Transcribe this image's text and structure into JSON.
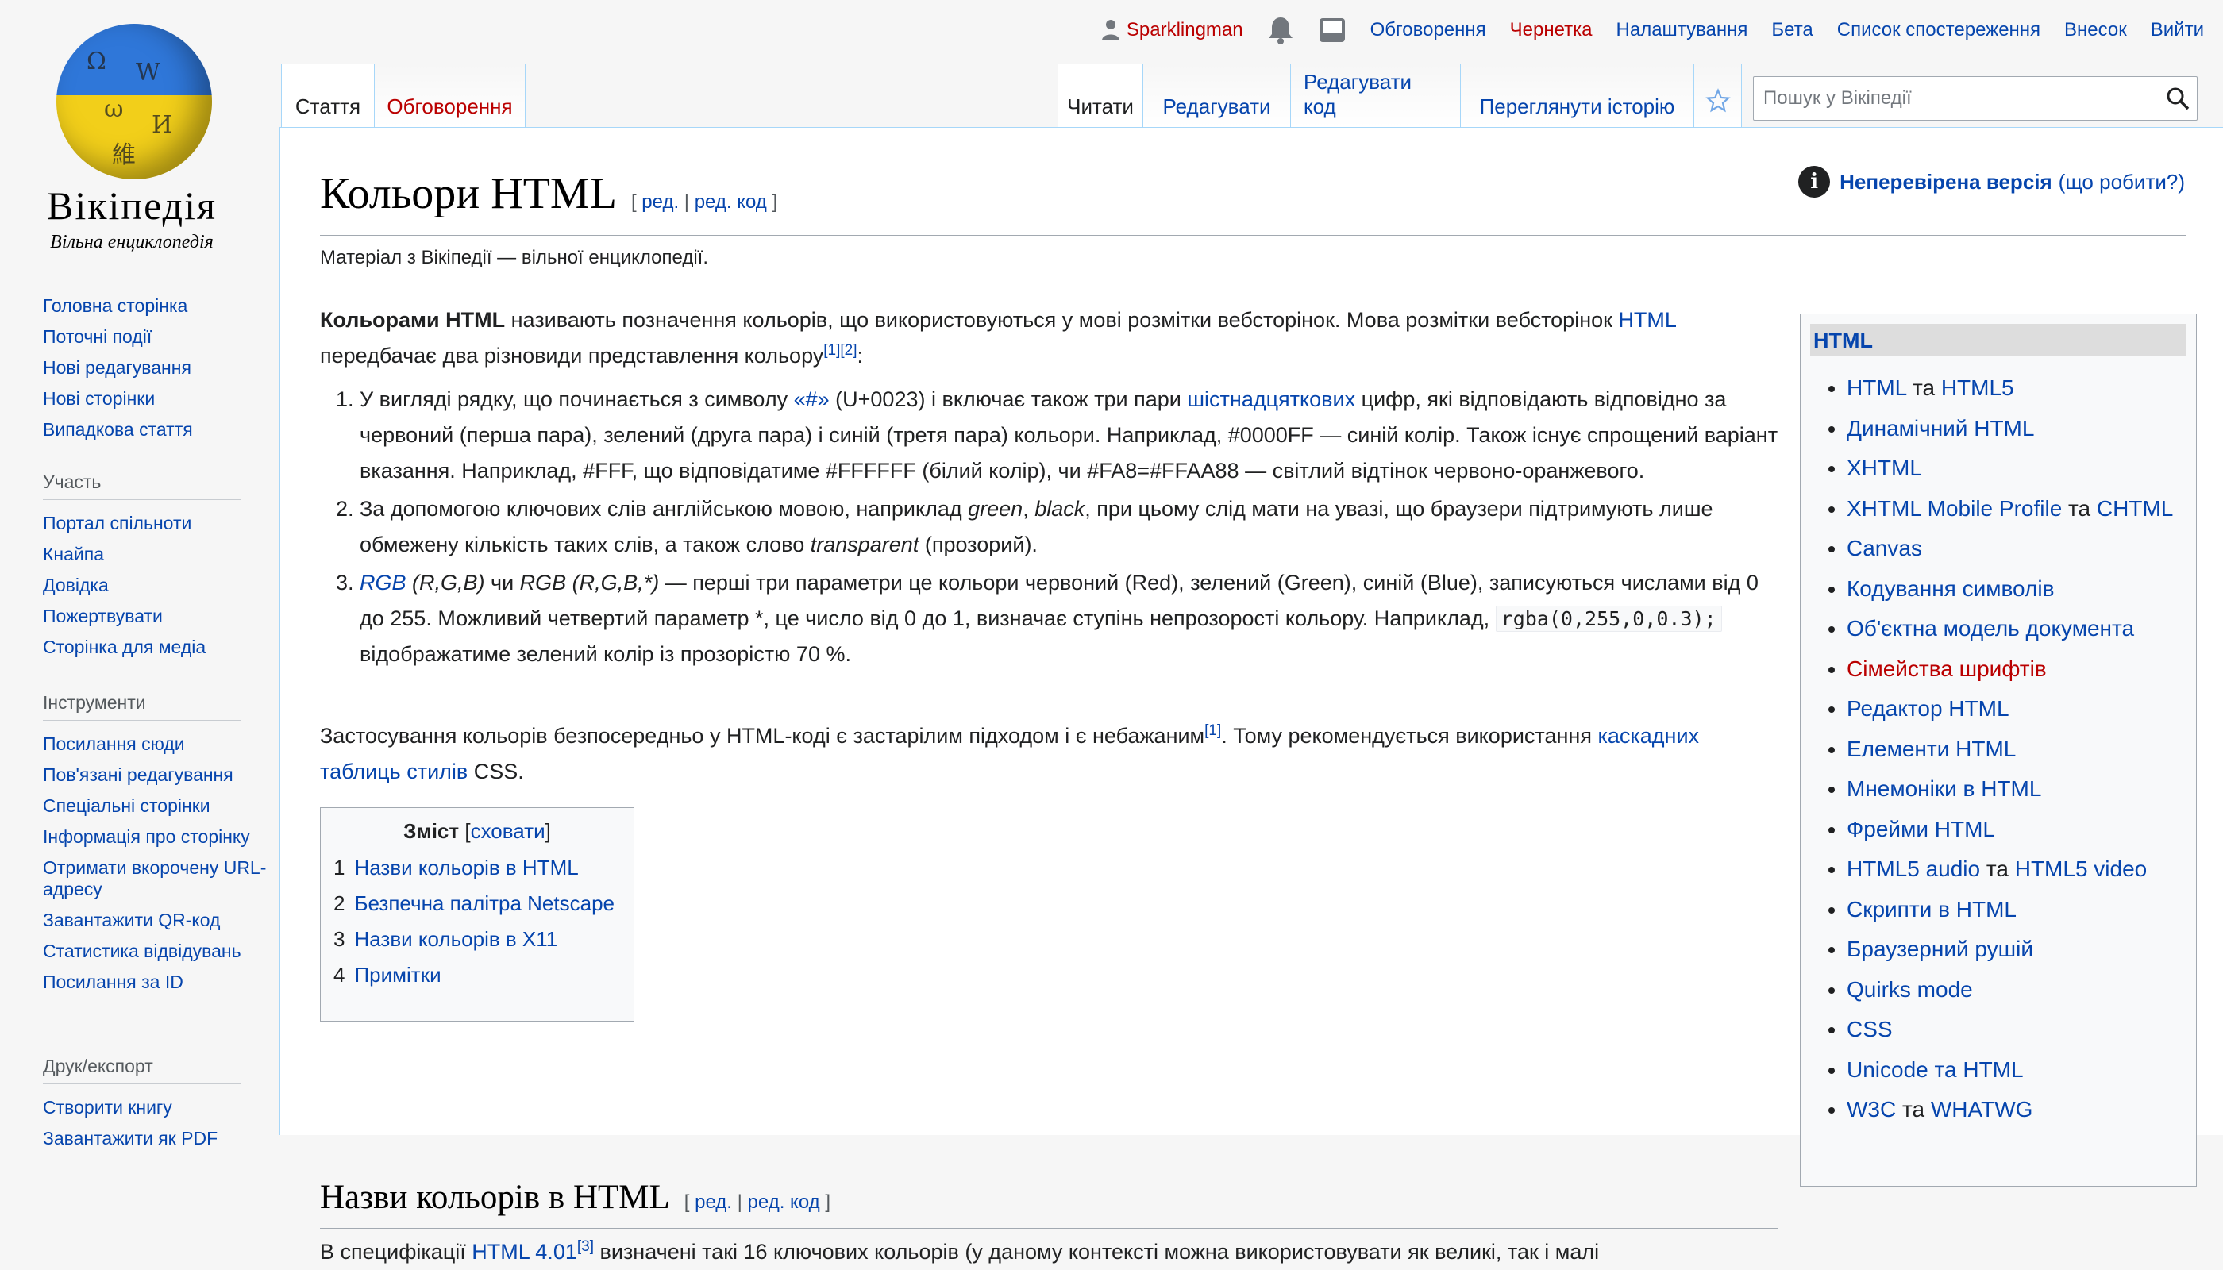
{
  "logo": {
    "wordmark": "Вікіпедія",
    "tagline": "Вільна енциклопедія",
    "colors": {
      "blue": "#2f77d9",
      "yellow": "#f2cf1a"
    }
  },
  "sidebar": {
    "main": [
      "Головна сторінка",
      "Поточні події",
      "Нові редагування",
      "Нові сторінки",
      "Випадкова стаття"
    ],
    "participation": {
      "heading": "Участь",
      "items": [
        "Портал спільноти",
        "Кнайпа",
        "Довідка",
        "Пожертвувати",
        "Сторінка для медіа"
      ]
    },
    "tools": {
      "heading": "Інструменти",
      "items": [
        "Посилання сюди",
        "Пов'язані редагування",
        "Спеціальні сторінки",
        "Інформація про сторінку",
        "Отримати вкорочену URL-адресу",
        "Завантажити QR-код",
        "Статистика відвідувань",
        "Посилання за ID"
      ]
    },
    "print": {
      "heading": "Друк/експорт",
      "items": [
        "Створити книгу",
        "Завантажити як PDF"
      ]
    }
  },
  "personal": {
    "username": "Sparklingman",
    "talk": "Обговорення",
    "draft": "Чернетка",
    "preferences": "Налаштування",
    "beta": "Бета",
    "watchlist": "Список спостереження",
    "contributions": "Внесок",
    "logout": "Вийти"
  },
  "tabs": {
    "article": "Стаття",
    "talk": "Обговорення",
    "read": "Читати",
    "edit": "Редагувати",
    "edit_code": "Редагувати код",
    "history": "Переглянути історію"
  },
  "search": {
    "placeholder": "Пошук у Вікіпедії"
  },
  "page": {
    "title": "Кольори HTML",
    "edit_bracket_open": "[",
    "edit": "ред.",
    "edit_sep": "|",
    "edit_code": "ред. код",
    "edit_bracket_close": "]",
    "flagged_link": "Неперевірена версія",
    "flagged_help": "(що робити?)",
    "site_sub": "Матеріал з Вікіпедії — вільної енциклопедії."
  },
  "intro": {
    "bold": "Кольорами HTML",
    "text1": " називають позначення кольорів, що використовуються у мові розмітки вебсторінок. Мова розмітки вебсторінок ",
    "link_html": "HTML",
    "text2": " передбачає два різновиди представлення кольору",
    "ref12": "[1][2]",
    "colon": ":"
  },
  "list": {
    "item1": {
      "t1": "У вигляді рядку, що починається з символу ",
      "link_hash": "«#»",
      "t2": " (U+0023) і включає також три пари ",
      "link_hex": "шістнадцяткових",
      "t3": " цифр, які відповідають відповідно за червоний (перша пара), зелений (друга пара) і синій (третя пара) кольори. Наприклад, #0000FF — синій колір. Також існує спрощений варіант вказання. Наприклад, #FFF, що відповідатиме #FFFFFF (білий колір), чи #FA8=#FFAA88 — світлий відтінок червоно-оранжевого."
    },
    "item2": {
      "t1": "За допомогою ключових слів англійською мовою, наприклад ",
      "green": "green",
      "comma": ", ",
      "black": "black",
      "t2": ", при цьому слід мати на увазі, що браузери підтримують лише обмежену кількість таких слів, а також слово ",
      "transparent": "transparent",
      "t3": " (прозорий)."
    },
    "item3": {
      "link_rgb": "RGB",
      "rgb_args": " (R,G,B)",
      "t1": " чи ",
      "rgba": "RGB (R,G,B,*)",
      "t2": " — перші три параметри це кольори червоний (Red), зелений (Green), синій (Blue), записуються числами від 0 до 255. Можливий четвертий параметр *, це число від 0 до 1, визначає ступінь непрозорості кольору. Наприклад, ",
      "code": "rgba(0,255,0,0.3);",
      "t3": " відображатиме зелений колір із прозорістю 70 %."
    }
  },
  "para2": {
    "t1": "Застосування кольорів безпосередньо у HTML-коді є застарілим підходом і є небажаним",
    "ref1": "[1]",
    "t2": ". Тому рекомендується використання ",
    "link_css": "каскадних таблиць стилів",
    "t3": " CSS."
  },
  "toc": {
    "title": "Зміст",
    "hide_open": " [",
    "hide": "сховати",
    "hide_close": "]",
    "items": [
      {
        "num": "1",
        "label": "Назви кольорів в HTML"
      },
      {
        "num": "2",
        "label": "Безпечна палітра Netscape"
      },
      {
        "num": "3",
        "label": "Назви кольорів в X11"
      },
      {
        "num": "4",
        "label": "Примітки"
      }
    ]
  },
  "section1": {
    "title": "Назви кольорів в HTML"
  },
  "para3": {
    "t1": "В специфікації ",
    "link": "HTML 4.01",
    "ref": "[3]",
    "t2": " визначені такі 16 ключових кольорів (у даному контексті можна використовувати як великі, так і малі"
  },
  "navbox": {
    "title": "HTML",
    "items": [
      {
        "a": "HTML",
        "sep": " та ",
        "b": "HTML5"
      },
      {
        "a": "Динамічний HTML"
      },
      {
        "a": "XHTML"
      },
      {
        "a": "XHTML Mobile Profile",
        "sep": " та ",
        "b": "CHTML"
      },
      {
        "a": "Canvas"
      },
      {
        "a": "Кодування символів"
      },
      {
        "a": "Об'єктна модель документа"
      },
      {
        "a": "Сімейства шрифтів",
        "red": true
      },
      {
        "a": "Редактор HTML"
      },
      {
        "a": "Елементи HTML"
      },
      {
        "a": "Мнемоніки в HTML"
      },
      {
        "a": "Фрейми HTML"
      },
      {
        "a": "HTML5 audio",
        "sep": " та ",
        "b": "HTML5 video"
      },
      {
        "a": "Скрипти в HTML"
      },
      {
        "a": "Браузерний рушій"
      },
      {
        "a": "Quirks mode"
      },
      {
        "a": "CSS"
      },
      {
        "a": "Unicode та HTML"
      },
      {
        "a": "W3C",
        "sep": " та ",
        "b": "WHATWG"
      }
    ]
  },
  "colors": {
    "link": "#0645ad",
    "redlink": "#ba0000",
    "border": "#a7d7f9"
  }
}
